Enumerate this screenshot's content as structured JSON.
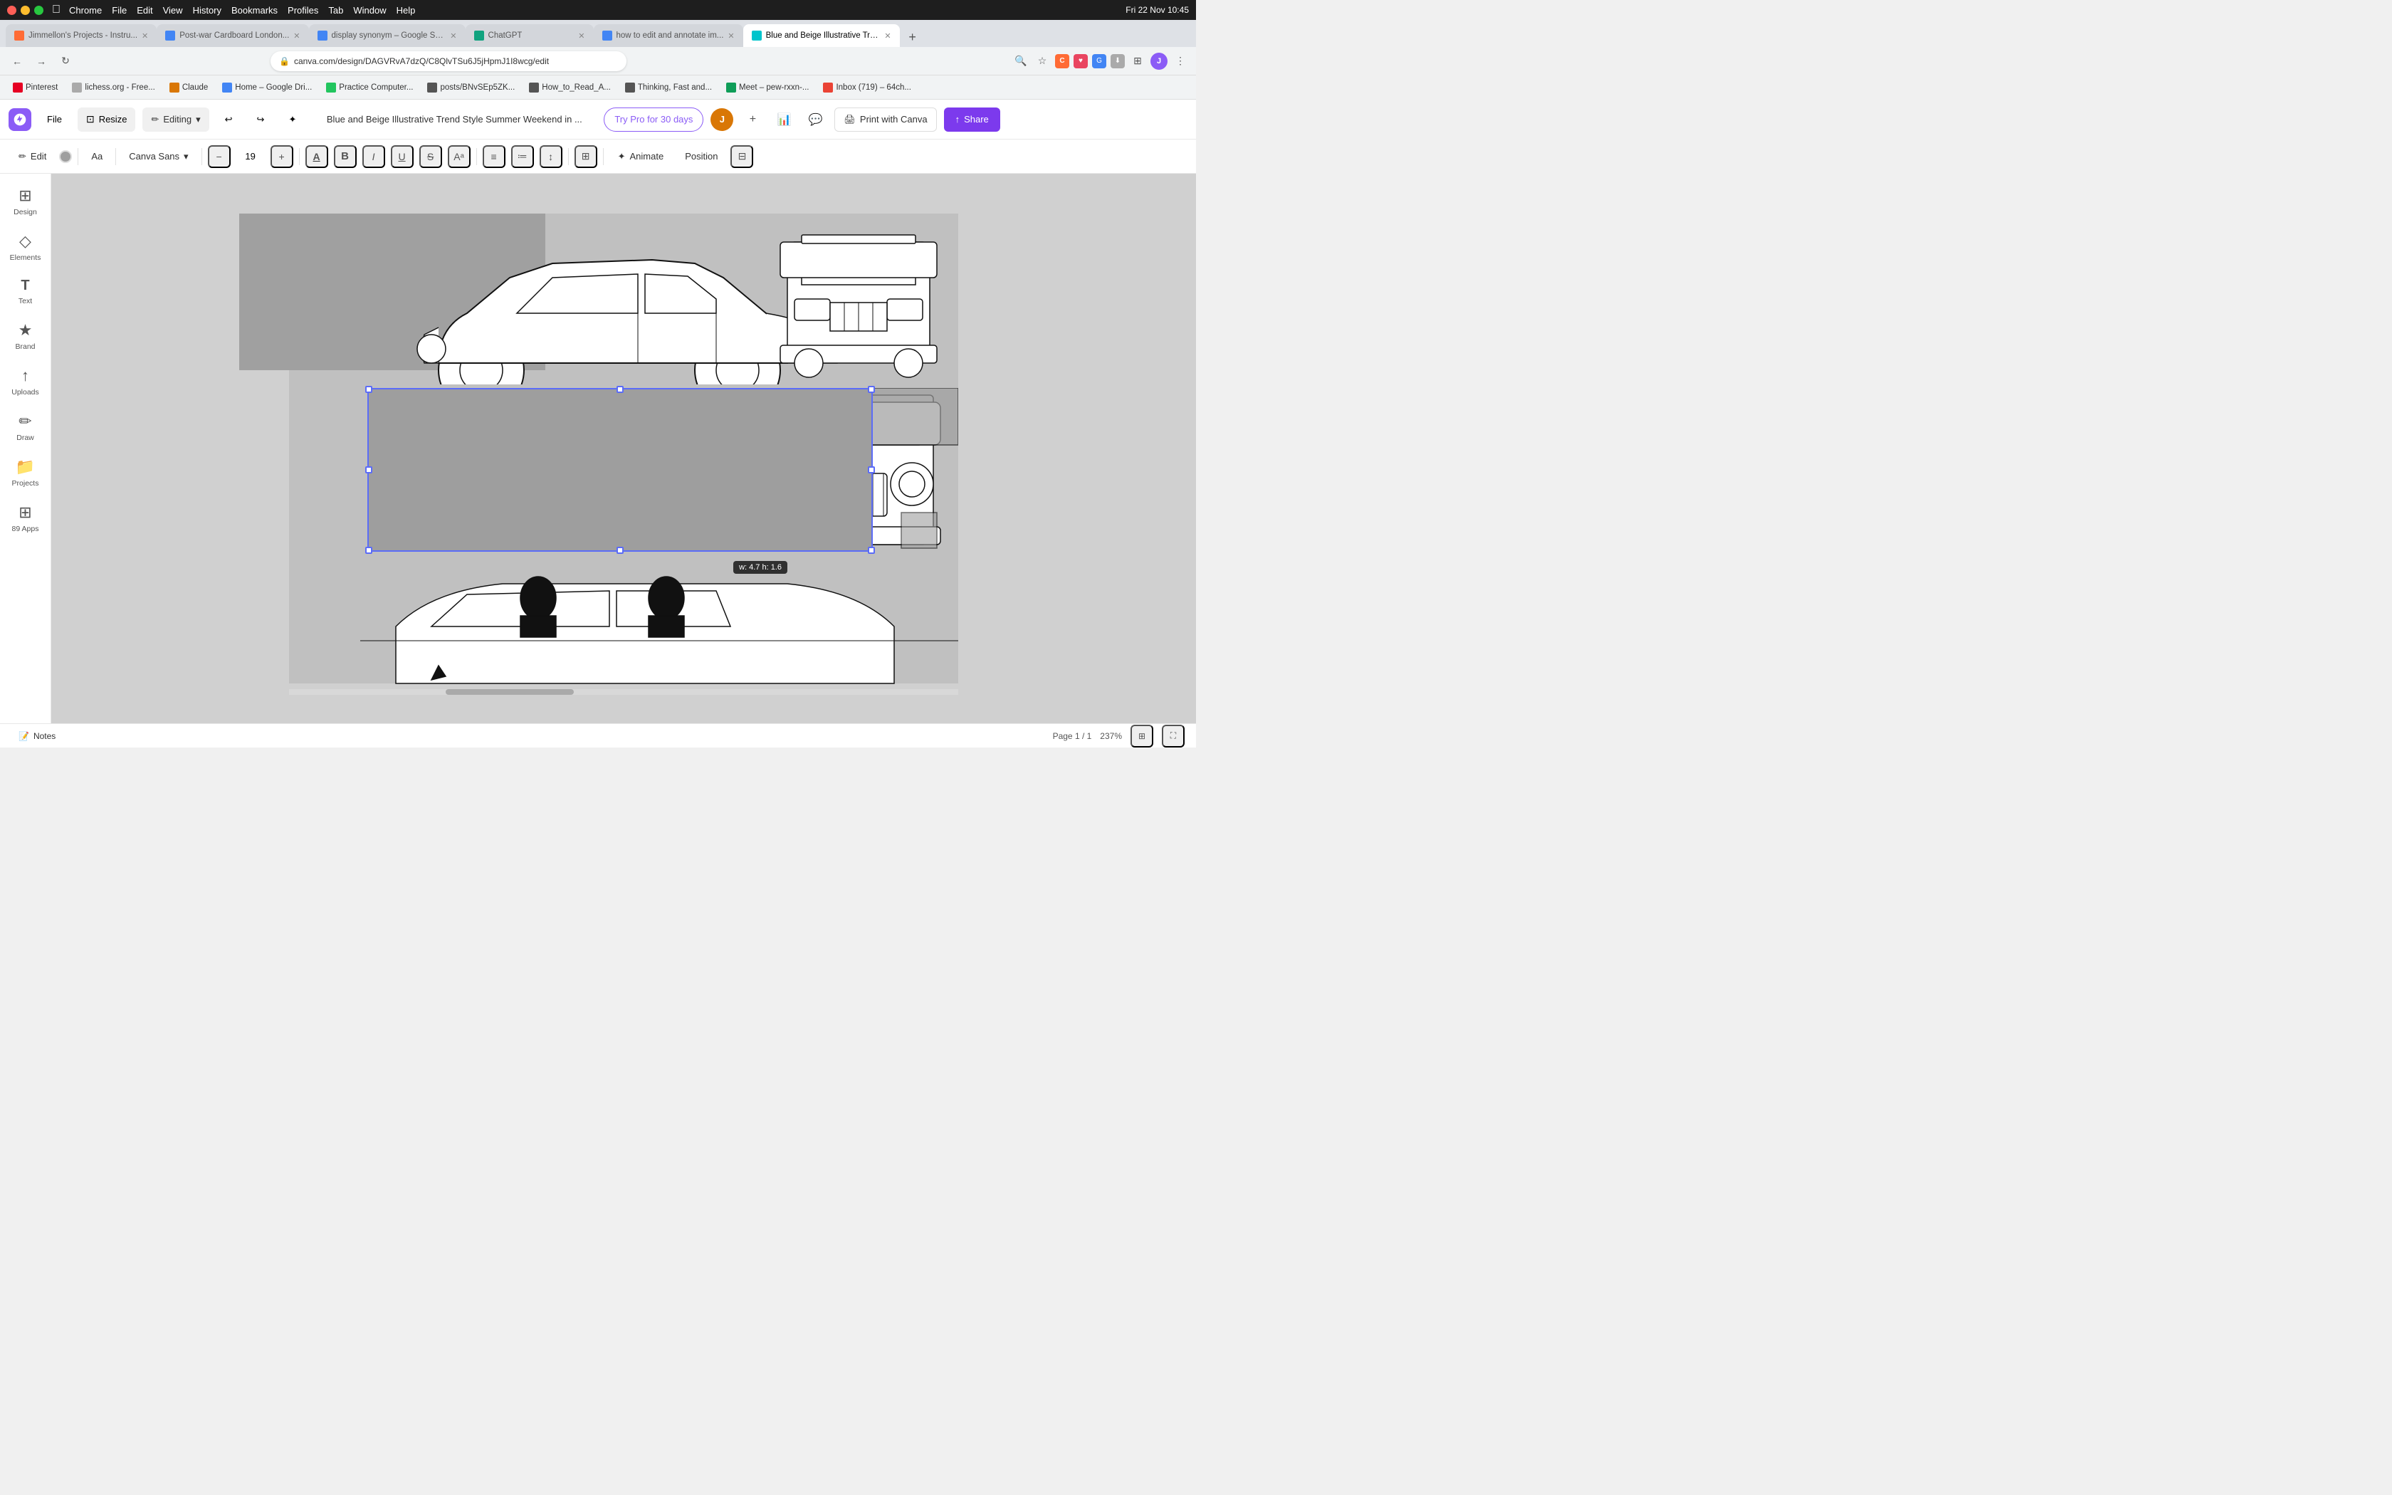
{
  "mac": {
    "dots": [
      "red",
      "yellow",
      "green"
    ],
    "app": "Chrome",
    "menus": [
      "Chrome",
      "File",
      "Edit",
      "View",
      "History",
      "Bookmarks",
      "Profiles",
      "Tab",
      "Window",
      "Help"
    ],
    "time": "Fri 22 Nov  10:45"
  },
  "tabs": [
    {
      "id": "tab1",
      "title": "Jimmellon's Projects - Instru...",
      "active": false,
      "favicon_color": "#ff6b35"
    },
    {
      "id": "tab2",
      "title": "Post-war Cardboard London...",
      "active": false,
      "favicon_color": "#4285f4"
    },
    {
      "id": "tab3",
      "title": "display synonym – Google Se...",
      "active": false,
      "favicon_color": "#4285f4"
    },
    {
      "id": "tab4",
      "title": "ChatGPT",
      "active": false,
      "favicon_color": "#10a37f"
    },
    {
      "id": "tab5",
      "title": "how to edit and annotate im...",
      "active": false,
      "favicon_color": "#4285f4"
    },
    {
      "id": "tab6",
      "title": "Blue and Beige Illustrative Tre...",
      "active": true,
      "favicon_color": "#00c4cc"
    }
  ],
  "url": "canva.com/design/DAGVRvA7dzQ/C8QlvTSu6J5jHpmJ1I8wcg/edit",
  "bookmarks": [
    {
      "label": "Pinterest",
      "favicon_color": "#e60023"
    },
    {
      "label": "lichess.org - Free...",
      "favicon_color": "#aaa"
    },
    {
      "label": "Claude",
      "favicon_color": "#d97706"
    },
    {
      "label": "Home – Google Dri...",
      "favicon_color": "#4285f4"
    },
    {
      "label": "Practice Computer...",
      "favicon_color": "#22c55e"
    },
    {
      "label": "posts/BNvSEp5ZK...",
      "favicon_color": "#555"
    },
    {
      "label": "How_to_Read_A...",
      "favicon_color": "#555"
    },
    {
      "label": "Thinking, Fast and...",
      "favicon_color": "#555"
    },
    {
      "label": "Meet – pew-rxxn-...",
      "favicon_color": "#0f9d58"
    },
    {
      "label": "Inbox (719) – 64ch...",
      "favicon_color": "#ea4335"
    }
  ],
  "header": {
    "file_label": "File",
    "resize_label": "Resize",
    "editing_label": "Editing",
    "undo_icon": "↩",
    "redo_icon": "↪",
    "doc_title": "Blue and Beige Illustrative Trend Style Summer Weekend in ...",
    "try_pro_label": "Try Pro for 30 days",
    "print_label": "Print with Canva",
    "share_label": "Share",
    "plus_icon": "+",
    "comment_icon": "💬",
    "chart_icon": "📊"
  },
  "toolbar": {
    "edit_label": "Edit",
    "font_name": "Canva Sans",
    "font_size": "19",
    "minus_label": "−",
    "plus_label": "+",
    "bold_label": "B",
    "italic_label": "I",
    "underline_label": "U",
    "strikethrough_label": "S",
    "superscript_label": "Aᵃ",
    "align_label": "≡",
    "list_label": "≔",
    "spacing_label": "↕",
    "effects_label": "⊞",
    "animate_label": "Animate",
    "position_label": "Position",
    "filter_icon": "⊟"
  },
  "sidebar": {
    "items": [
      {
        "id": "design",
        "icon": "⊞",
        "label": "Design"
      },
      {
        "id": "elements",
        "icon": "◇",
        "label": "Elements"
      },
      {
        "id": "text",
        "icon": "T",
        "label": "Text"
      },
      {
        "id": "brand",
        "icon": "★",
        "label": "Brand"
      },
      {
        "id": "uploads",
        "icon": "↑",
        "label": "Uploads"
      },
      {
        "id": "draw",
        "icon": "✏",
        "label": "Draw"
      },
      {
        "id": "projects",
        "icon": "📁",
        "label": "Projects"
      },
      {
        "id": "apps",
        "icon": "⊞",
        "label": "89 Apps"
      }
    ]
  },
  "canvas": {
    "dimensions_tooltip": "w: 4.7 h: 1.6",
    "bg_color": "#cccccc"
  },
  "status": {
    "notes_label": "Notes",
    "page_label": "Page 1 / 1",
    "zoom_level": "237%",
    "grid_icon": "⊞",
    "fullscreen_icon": "⛶"
  }
}
